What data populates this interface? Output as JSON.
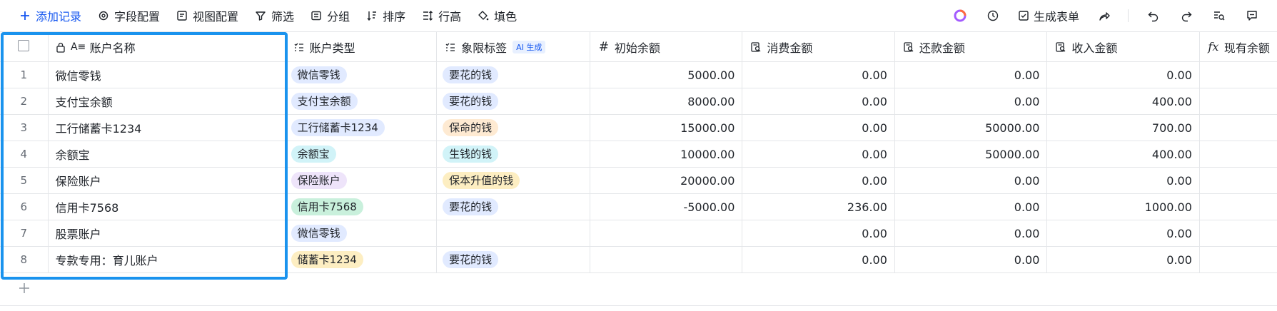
{
  "toolbar": {
    "add_record": "添加记录",
    "field_config": "字段配置",
    "view_config": "视图配置",
    "filter": "筛选",
    "group": "分组",
    "sort": "排序",
    "row_height": "行高",
    "fill_color": "填色",
    "generate_form": "生成表单"
  },
  "columns": {
    "name": "账户名称",
    "type": "账户类型",
    "quadrant": "象限标签",
    "ai_badge": "AI 生成",
    "initial": "初始余额",
    "spend": "消费金额",
    "repay": "还款金额",
    "income": "收入金额",
    "current": "现有余额"
  },
  "colors": {
    "accent": "#1456f0",
    "selection_border": "#1a93ee",
    "tag_blue": "#e1eaff",
    "tag_orange": "#feead2",
    "tag_cyan": "#d1f3f8",
    "tag_purple": "#eee4fa",
    "tag_green": "#c9f0dc",
    "tag_yellow": "#fdeec2"
  },
  "rows": [
    {
      "idx": "1",
      "name": "微信零钱",
      "type": "微信零钱",
      "type_color": "#e1eaff",
      "quad": "要花的钱",
      "quad_color": "#e1eaff",
      "initial": "5000.00",
      "spend": "0.00",
      "repay": "0.00",
      "income": "0.00"
    },
    {
      "idx": "2",
      "name": "支付宝余额",
      "type": "支付宝余额",
      "type_color": "#e1eaff",
      "quad": "要花的钱",
      "quad_color": "#e1eaff",
      "initial": "8000.00",
      "spend": "0.00",
      "repay": "0.00",
      "income": "400.00"
    },
    {
      "idx": "3",
      "name": "工行储蓄卡1234",
      "type": "工行储蓄卡1234",
      "type_color": "#e1eaff",
      "quad": "保命的钱",
      "quad_color": "#feead2",
      "initial": "15000.00",
      "spend": "0.00",
      "repay": "50000.00",
      "income": "700.00"
    },
    {
      "idx": "4",
      "name": "余额宝",
      "type": "余额宝",
      "type_color": "#d1f3f8",
      "quad": "生钱的钱",
      "quad_color": "#d1f3f8",
      "initial": "10000.00",
      "spend": "0.00",
      "repay": "50000.00",
      "income": "400.00"
    },
    {
      "idx": "5",
      "name": "保险账户",
      "type": "保险账户",
      "type_color": "#eee4fa",
      "quad": "保本升值的钱",
      "quad_color": "#fdeec2",
      "initial": "20000.00",
      "spend": "0.00",
      "repay": "0.00",
      "income": "0.00"
    },
    {
      "idx": "6",
      "name": "信用卡7568",
      "type": "信用卡7568",
      "type_color": "#c9f0dc",
      "quad": "要花的钱",
      "quad_color": "#e1eaff",
      "initial": "-5000.00",
      "spend": "236.00",
      "repay": "0.00",
      "income": "1000.00"
    },
    {
      "idx": "7",
      "name": "股票账户",
      "type": "微信零钱",
      "type_color": "#e1eaff",
      "quad": "",
      "quad_color": "",
      "initial": "",
      "spend": "0.00",
      "repay": "0.00",
      "income": "0.00"
    },
    {
      "idx": "8",
      "name": "专款专用：育儿账户",
      "type": "储蓄卡1234",
      "type_color": "#fdeec2",
      "quad": "要花的钱",
      "quad_color": "#e1eaff",
      "initial": "",
      "spend": "0.00",
      "repay": "0.00",
      "income": "0.00"
    }
  ]
}
